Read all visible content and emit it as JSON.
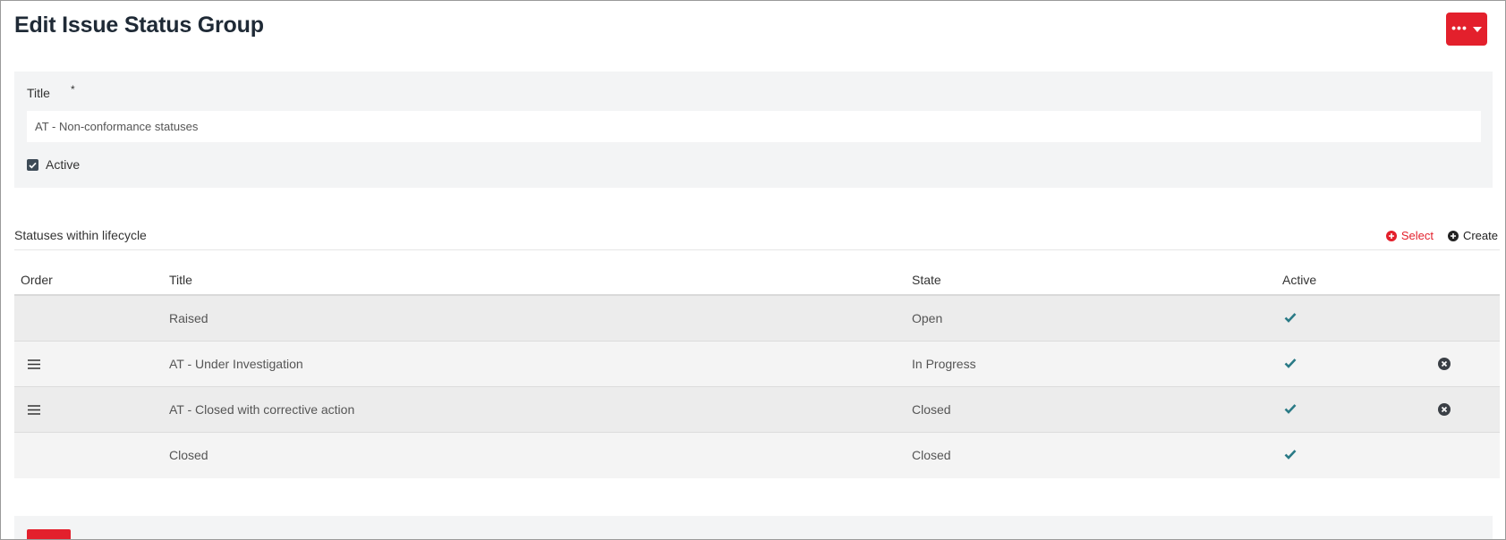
{
  "page": {
    "title": "Edit Issue Status Group"
  },
  "toolbar": {
    "more_label": "•••"
  },
  "form": {
    "title_label": "Title",
    "required_mark": "*",
    "title_value": "AT - Non-conformance statuses",
    "active_label": "Active",
    "active_checked": true
  },
  "section": {
    "title": "Statuses within lifecycle",
    "select_label": "Select",
    "create_label": "Create"
  },
  "table": {
    "columns": [
      "Order",
      "Title",
      "State",
      "Active"
    ],
    "rows": [
      {
        "title": "Raised",
        "state": "Open",
        "active": true,
        "draggable": false,
        "removable": false
      },
      {
        "title": "AT - Under Investigation",
        "state": "In Progress",
        "active": true,
        "draggable": true,
        "removable": true
      },
      {
        "title": "AT - Closed with corrective action",
        "state": "Closed",
        "active": true,
        "draggable": true,
        "removable": true
      },
      {
        "title": "Closed",
        "state": "Closed",
        "active": true,
        "draggable": false,
        "removable": false
      }
    ]
  },
  "colors": {
    "accent": "#e3202c",
    "check": "#2a7a86",
    "panel": "#f3f4f5",
    "title_text": "#1f2a36"
  },
  "icons": {
    "more": "ellipsis-icon",
    "caret": "caret-down-icon",
    "select": "plus-circle-icon",
    "create": "plus-circle-icon",
    "drag": "drag-handle-icon",
    "active": "check-icon",
    "remove": "remove-circle-icon"
  }
}
